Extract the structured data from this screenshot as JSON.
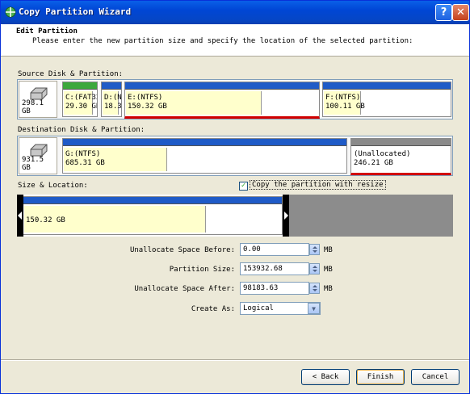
{
  "window": {
    "title": "Copy Partition Wizard"
  },
  "header": {
    "title": "Edit Partition",
    "subtitle": "Please enter the new partition size and specify the location of the selected partition:"
  },
  "source": {
    "label": "Source Disk & Partition:",
    "disk_size": "298.1 GB",
    "partitions": [
      {
        "name": "C:(FAT32)",
        "size": "29.30 GB"
      },
      {
        "name": "D:(NTFS)",
        "size": "18.3"
      },
      {
        "name": "E:(NTFS)",
        "size": "150.32 GB"
      },
      {
        "name": "F:(NTFS)",
        "size": "100.11 GB"
      }
    ]
  },
  "destination": {
    "label": "Destination Disk & Partition:",
    "disk_size": "931.5 GB",
    "partitions": [
      {
        "name": "G:(NTFS)",
        "size": "685.31 GB"
      },
      {
        "name": "(Unallocated)",
        "size": "246.21 GB"
      }
    ]
  },
  "size_location": {
    "label": "Size & Location:",
    "copy_resize_label": "Copy the partition with resize",
    "copy_resize_checked": true,
    "block_size": "150.32 GB"
  },
  "fields": {
    "unallocated_before": {
      "label": "Unallocate Space Before:",
      "value": "0.00",
      "unit": "MB"
    },
    "partition_size": {
      "label": "Partition Size:",
      "value": "153932.68",
      "unit": "MB"
    },
    "unallocated_after": {
      "label": "Unallocate Space After:",
      "value": "98183.63",
      "unit": "MB"
    },
    "create_as": {
      "label": "Create As:",
      "value": "Logical"
    }
  },
  "buttons": {
    "back": "< Back",
    "finish": "Finish",
    "cancel": "Cancel"
  },
  "colors": {
    "accent": "#0a5fe8",
    "bar_blue": "#1f5bc7",
    "bar_green": "#3ca83c",
    "bar_gray": "#8a8a8a",
    "selected_red": "#d10000"
  }
}
